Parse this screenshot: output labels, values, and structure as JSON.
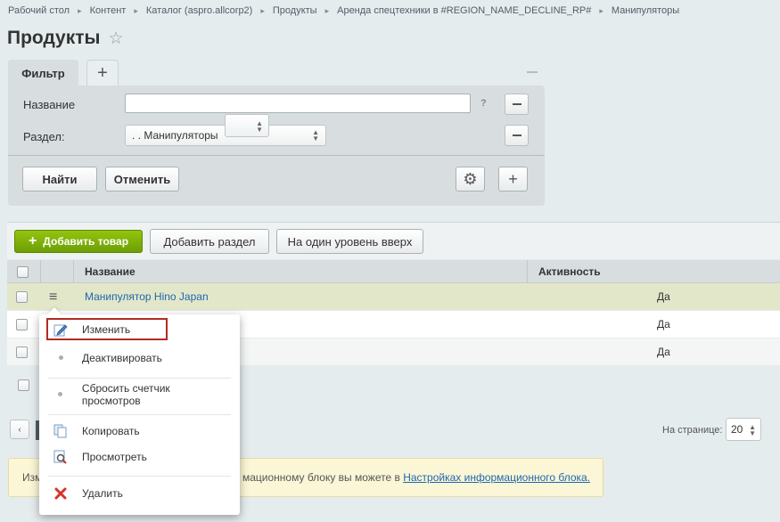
{
  "breadcrumb": [
    "Рабочий стол",
    "Контент",
    "Каталог (aspro.allcorp2)",
    "Продукты",
    "Аренда спецтехники в #REGION_NAME_DECLINE_RP#",
    "Манипуляторы"
  ],
  "page": {
    "title": "Продукты",
    "favorite_icon": "☆"
  },
  "filter": {
    "tab_label": "Фильтр",
    "add_tab_icon": "+",
    "fields": {
      "name_label": "Название",
      "name_value": "",
      "help": "?",
      "section_label": "Раздел:",
      "section_value": ". . Манипуляторы"
    },
    "find_button": "Найти",
    "cancel_button": "Отменить",
    "settings_icon": "⚙",
    "add_field_icon": "+"
  },
  "toolbar": {
    "add_product": "Добавить товар",
    "add_section": "Добавить раздел",
    "level_up": "На один уровень вверх"
  },
  "grid": {
    "columns": {
      "name": "Название",
      "active": "Активность"
    },
    "rows": [
      {
        "name": "Манипулятор Hino Japan",
        "active": "Да"
      },
      {
        "name": "",
        "active": "Да"
      },
      {
        "name": "",
        "active": "Да"
      }
    ]
  },
  "pagination": {
    "prev_icon": "‹",
    "per_page_label": "На странице:",
    "per_page_value": "20"
  },
  "notice": {
    "text_start": "Изм",
    "text_end": "мационному блоку вы можете в",
    "link": "Настройках информационного блока."
  },
  "context_menu": {
    "items": [
      {
        "label": "Изменить",
        "icon": "edit-icon"
      },
      {
        "label": "Деактивировать",
        "icon": "dot-icon"
      },
      {
        "label": "Сбросить счетчик просмотров",
        "icon": "dot-icon"
      },
      {
        "label": "Копировать",
        "icon": "copy-icon"
      },
      {
        "label": "Просмотреть",
        "icon": "view-icon"
      },
      {
        "label": "Удалить",
        "icon": "delete-icon"
      }
    ]
  },
  "colors": {
    "accent_green": "#7aab08",
    "link_blue": "#2067b0",
    "highlight_row": "#e2e7c9",
    "selected_border": "#b22a22"
  }
}
